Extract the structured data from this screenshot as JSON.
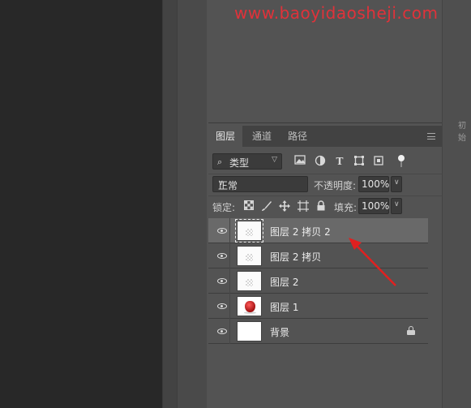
{
  "watermark": "www.baoyidaosheji.com",
  "side_label": "初始",
  "tabs": [
    {
      "label": "图层",
      "active": true
    },
    {
      "label": "通道",
      "active": false
    },
    {
      "label": "路径",
      "active": false
    }
  ],
  "filter": {
    "kind_label": "类型",
    "icons": [
      "image-filter-icon",
      "adjustment-filter-icon",
      "type-filter-icon",
      "shape-filter-icon",
      "smart-object-filter-icon",
      "filter-toggle-icon"
    ]
  },
  "blend_mode": "正常",
  "opacity": {
    "label": "不透明度:",
    "value": "100%"
  },
  "lock": {
    "label": "锁定:",
    "icons": [
      "lock-transparent-icon",
      "lock-image-icon",
      "lock-position-icon",
      "lock-artboard-icon",
      "lock-all-icon"
    ]
  },
  "fill": {
    "label": "填充:",
    "value": "100%"
  },
  "layers": [
    {
      "name": "图层 2 拷贝 2",
      "selected": true,
      "thumb": "transparent",
      "visible": true,
      "locked": false
    },
    {
      "name": "图层 2 拷贝",
      "selected": false,
      "thumb": "transparent",
      "visible": true,
      "locked": false
    },
    {
      "name": "图层 2",
      "selected": false,
      "thumb": "transparent",
      "visible": true,
      "locked": false
    },
    {
      "name": "图层 1",
      "selected": false,
      "thumb": "apple",
      "visible": true,
      "locked": false
    },
    {
      "name": "背景",
      "selected": false,
      "thumb": "white",
      "visible": true,
      "locked": true
    }
  ],
  "colors": {
    "watermark": "#e0323a",
    "annotation_arrow": "#e02020",
    "panel_bg": "#535353",
    "selected_layer": "#696969"
  }
}
